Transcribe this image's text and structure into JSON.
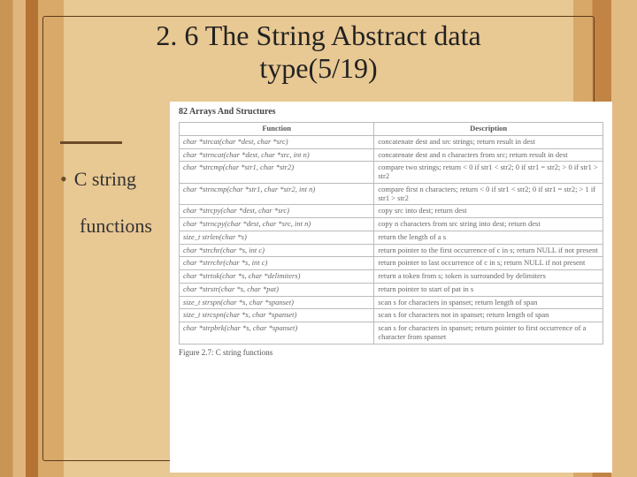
{
  "title_line1": "2. 6 The String Abstract data",
  "title_line2": "type(5/19)",
  "bullet_line1": "C string",
  "bullet_line2": "functions",
  "scan_header": "82   Arrays And Structures",
  "table_head_fn": "Function",
  "table_head_desc": "Description",
  "rows": [
    {
      "fn": "char *strcat(char *dest, char *src)",
      "desc": "concatenate dest and src strings; return result in dest"
    },
    {
      "fn": "char *strncat(char *dest, char *src, int n)",
      "desc": "concatenate dest and n characters from src; return result in dest"
    },
    {
      "fn": "char *strcmp(char *str1, char *str2)",
      "desc": "compare two strings; return < 0 if str1 < str2; 0 if str1 = str2; > 0 if str1 > str2"
    },
    {
      "fn": "char *strncmp(char *str1, char *str2, int n)",
      "desc": "compare first n characters; return < 0 if str1 < str2; 0 if str1 = str2; > 1 if str1 > str2"
    },
    {
      "fn": "char *strcpy(char *dest, char *src)",
      "desc": "copy src into dest; return dest"
    },
    {
      "fn": "char *strncpy(char *dest, char *src, int n)",
      "desc": "copy n characters from src string into dest; return dest"
    },
    {
      "fn": "size_t strlen(char *s)",
      "desc": "return the length of a s"
    },
    {
      "fn": "char *strchr(char *s, int c)",
      "desc": "return pointer to the first occurrence of c in s; return NULL if not present"
    },
    {
      "fn": "char *strrchr(char *s, int c)",
      "desc": "return pointer to last occurrence of c in s; return NULL if not present"
    },
    {
      "fn": "char *strtok(char *s, char *delimiters)",
      "desc": "return a token from s; token is surrounded by delimiters"
    },
    {
      "fn": "char *strstr(char *s, char *pat)",
      "desc": "return pointer to start of pat in s"
    },
    {
      "fn": "size_t strspn(char *s, char *spanset)",
      "desc": "scan s for characters in spanset; return length of span"
    },
    {
      "fn": "size_t strcspn(char *s, char *spanset)",
      "desc": "scan s for characters not in spanset; return length of span"
    },
    {
      "fn": "char *strpbrk(char *s, char *spanset)",
      "desc": "scan s for characters in spanset; return pointer to first occurrence of a character from spanset"
    }
  ],
  "figure_caption": "Figure 2.7: C string functions"
}
